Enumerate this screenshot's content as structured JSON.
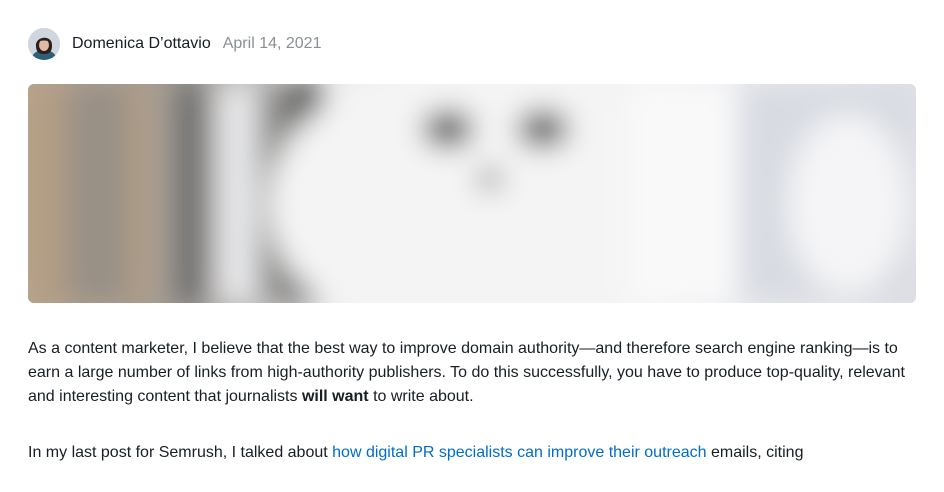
{
  "author": {
    "name": "Domenica D’ottavio",
    "date": "April 14, 2021",
    "avatar_icon": "avatar-photo"
  },
  "hero_image": {
    "description_icon": "blurred-cat-image"
  },
  "article": {
    "paragraph1": {
      "before_bold": "As a content marketer, I believe that the best way to improve domain authority—and therefore search engine ranking—is to earn a large number of links from high-authority publishers. To do this successfully, you have to produce top-quality, relevant and interesting content that journalists ",
      "bold": "will want",
      "after_bold": " to write about."
    },
    "paragraph2": {
      "before_link": "In my last post for Semrush, I talked about ",
      "link_text": "how digital PR specialists can improve their outreach",
      "after_link": " emails, citing"
    }
  },
  "colors": {
    "text": "#181e25",
    "muted": "#8a8f98",
    "link": "#006dca"
  }
}
